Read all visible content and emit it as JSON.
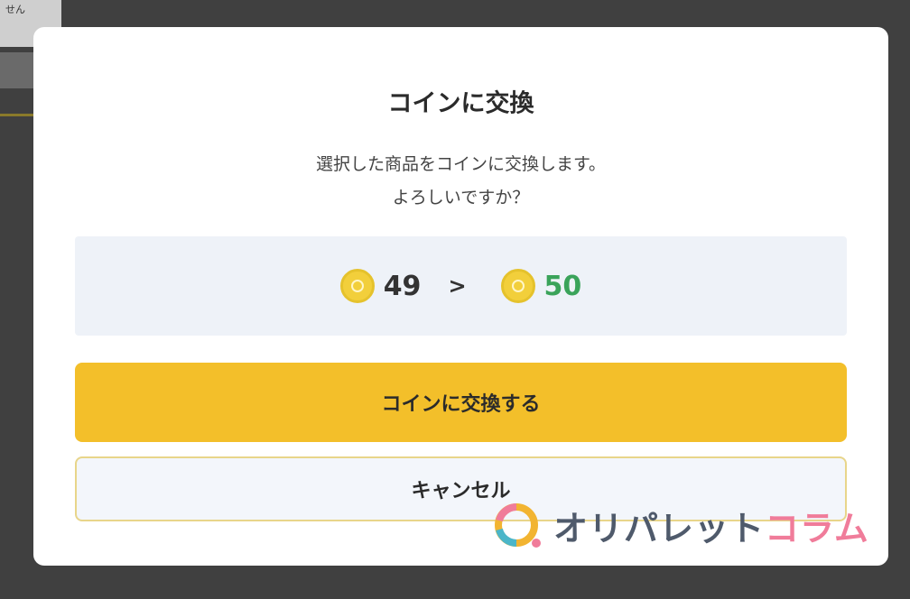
{
  "background": {
    "panel_text": "せん"
  },
  "dialog": {
    "title": "コインに交換",
    "message_line1": "選択した商品をコインに交換します。",
    "message_line2": "よろしいですか？",
    "exchange": {
      "coins_before": "49",
      "coins_after": "50",
      "arrow": ">"
    },
    "confirm_label": "コインに交換する",
    "cancel_label": "キャンセル"
  },
  "watermark": {
    "text_main": "オリパレット",
    "text_accent": "コラム"
  },
  "colors": {
    "accent": "#f3bf2a",
    "coin_gain": "#3aa35a",
    "exchange_bg": "#eef2f8"
  },
  "icons": {
    "coin": "coin-icon",
    "arrow": "chevron-right-icon"
  }
}
